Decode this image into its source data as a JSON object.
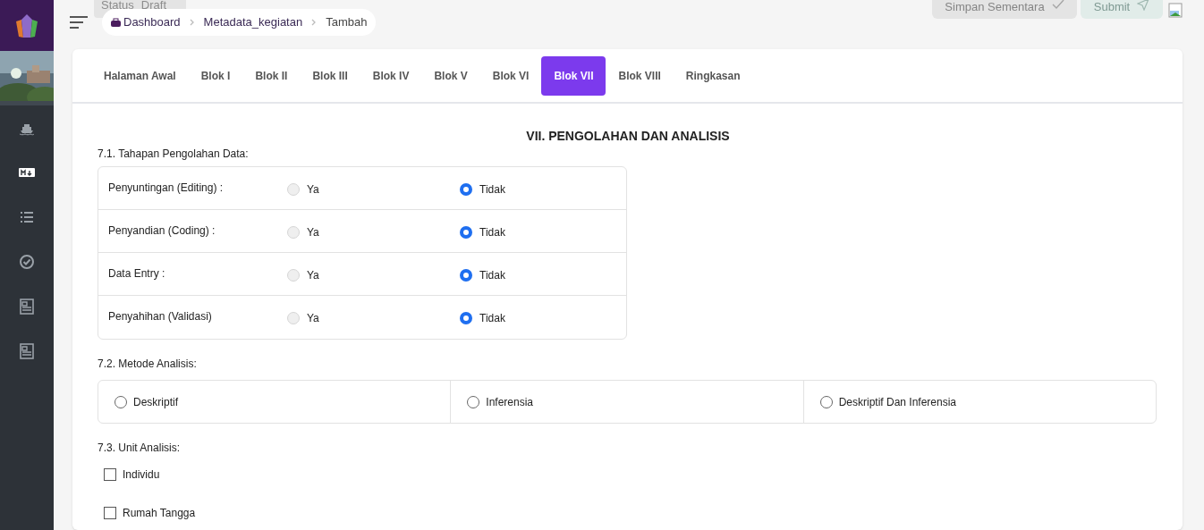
{
  "sidebar": {
    "items": [
      {
        "selected": false
      },
      {
        "selected": true
      },
      {
        "selected": false
      },
      {
        "selected": false
      },
      {
        "selected": false
      },
      {
        "selected": false
      }
    ]
  },
  "status_badge": {
    "label": "Status",
    "value": "Draft"
  },
  "breadcrumb": [
    "Dashboard",
    "Metadata_kegiatan",
    "Tambah"
  ],
  "actions": [
    {
      "label": "Simpan Sementara",
      "disabled": true,
      "kind": "save"
    },
    {
      "label": "Submit",
      "disabled": true,
      "kind": "submit"
    }
  ],
  "tabs": [
    {
      "label": "Halaman Awal",
      "selected": false
    },
    {
      "label": "Blok I",
      "selected": false
    },
    {
      "label": "Blok II",
      "selected": false
    },
    {
      "label": "Blok III",
      "selected": false
    },
    {
      "label": "Blok IV",
      "selected": false
    },
    {
      "label": "Blok V",
      "selected": false
    },
    {
      "label": "Blok VI",
      "selected": false
    },
    {
      "label": "Blok VII",
      "selected": true
    },
    {
      "label": "Blok VIII",
      "selected": false
    },
    {
      "label": "Ringkasan",
      "selected": false
    }
  ],
  "section_title": "VII. PENGOLAHAN DAN ANALISIS",
  "q71": {
    "label": "7.1. Tahapan Pengolahan Data:",
    "rows": [
      {
        "label": "Penyuntingan (Editing) :",
        "options": [
          {
            "label": "Ya",
            "selected": false
          },
          {
            "label": "Tidak",
            "selected": true
          }
        ]
      },
      {
        "label": "Penyandian (Coding) :",
        "options": [
          {
            "label": "Ya",
            "selected": false
          },
          {
            "label": "Tidak",
            "selected": true
          }
        ]
      },
      {
        "label": "Data Entry :",
        "options": [
          {
            "label": "Ya",
            "selected": false
          },
          {
            "label": "Tidak",
            "selected": true
          }
        ]
      },
      {
        "label": "Penyahihan (Validasi)",
        "options": [
          {
            "label": "Ya",
            "selected": false
          },
          {
            "label": "Tidak",
            "selected": true
          }
        ]
      }
    ]
  },
  "q72": {
    "label": "7.2. Metode Analisis:",
    "options": [
      {
        "label": "Deskriptif",
        "selected": false
      },
      {
        "label": "Inferensia",
        "selected": false
      },
      {
        "label": "Deskriptif Dan Inferensia",
        "selected": false
      }
    ]
  },
  "q73": {
    "label": "7.3. Unit Analisis:",
    "options": [
      {
        "label": "Individu",
        "checked": false
      },
      {
        "label": "Rumah Tangga",
        "checked": false
      }
    ]
  }
}
